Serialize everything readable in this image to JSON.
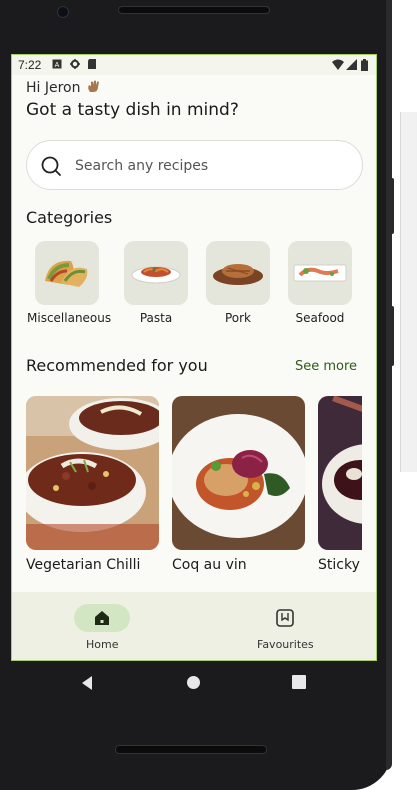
{
  "status": {
    "time": "7:22"
  },
  "greeting": "Hi Jeron",
  "headline": "Got a tasty dish in mind?",
  "search": {
    "placeholder": "Search any recipes"
  },
  "categories": {
    "title": "Categories",
    "items": [
      {
        "label": "Miscellaneous"
      },
      {
        "label": "Pasta"
      },
      {
        "label": "Pork"
      },
      {
        "label": "Seafood"
      }
    ]
  },
  "recommended": {
    "title": "Recommended for you",
    "see_more": "See more",
    "items": [
      {
        "label": "Vegetarian Chilli"
      },
      {
        "label": "Coq au vin"
      },
      {
        "label": "Sticky Toffee"
      }
    ]
  },
  "nav": {
    "home": "Home",
    "favourites": "Favourites"
  },
  "colors": {
    "accent": "#2f5a18",
    "nav_active": "#d3e6c4",
    "screen_bg": "#fafbf6"
  }
}
